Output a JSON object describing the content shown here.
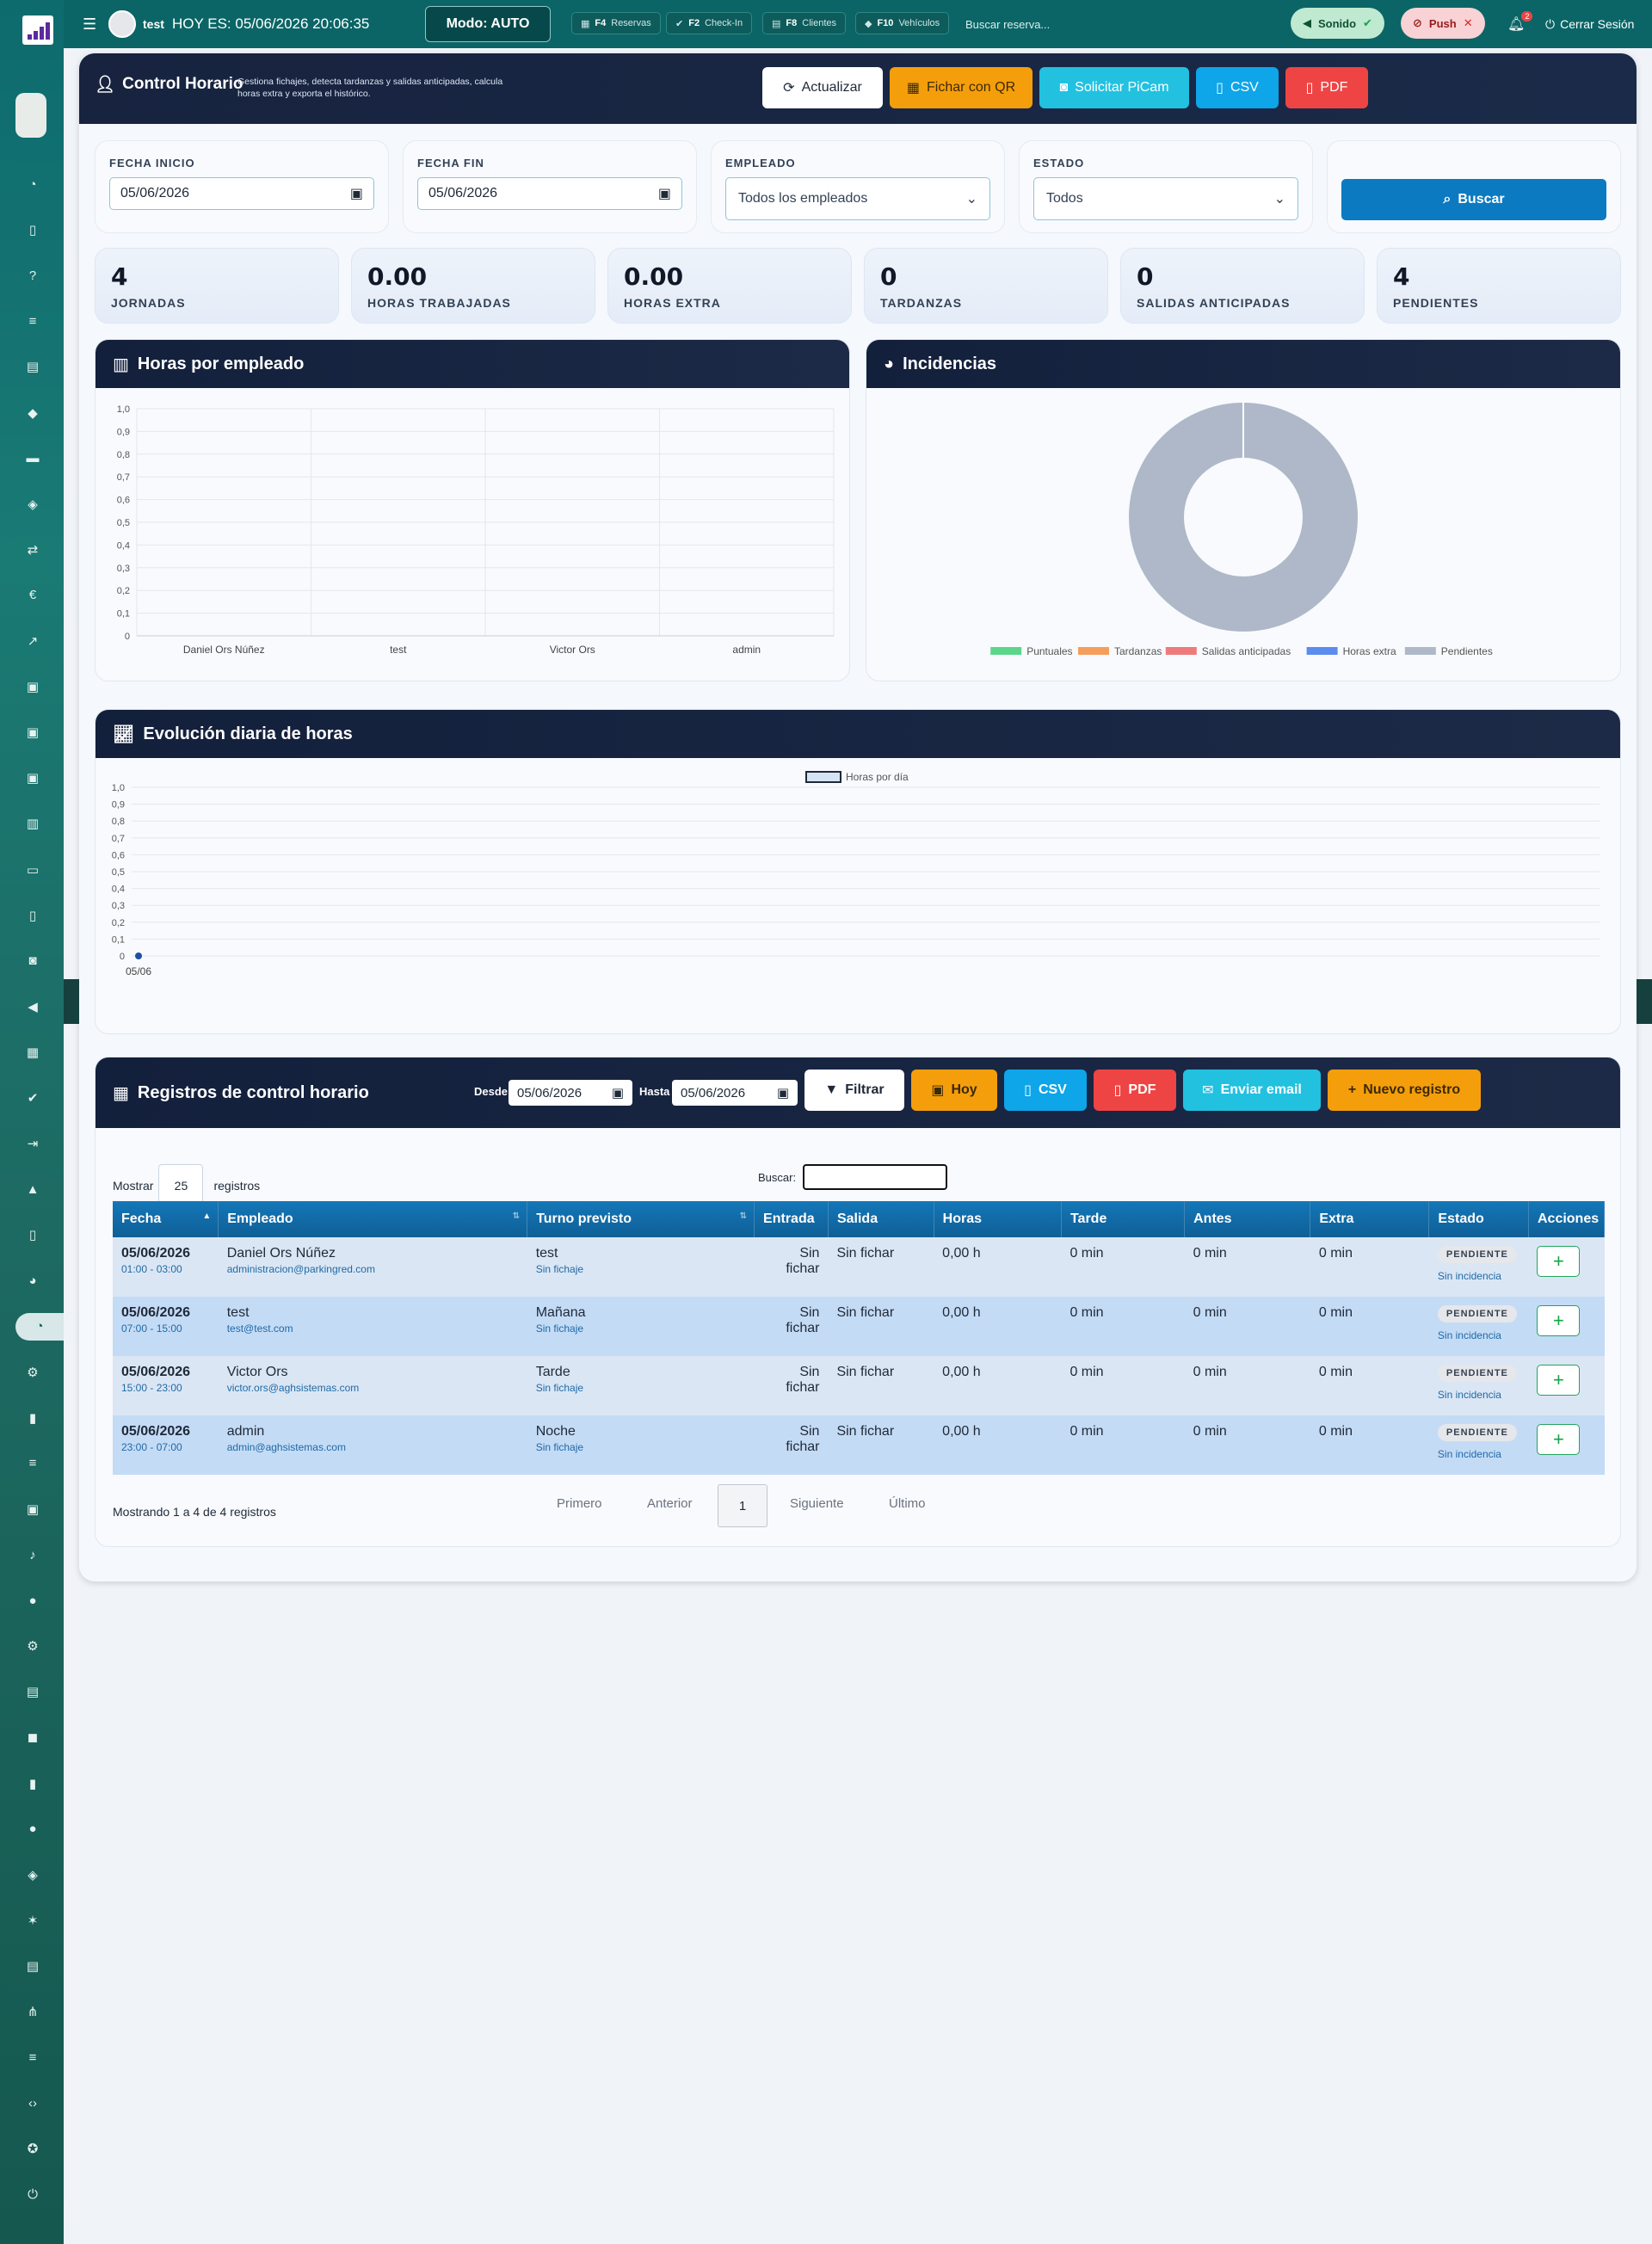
{
  "topbar": {
    "user": "test",
    "date_text": "HOY ES: 05/06/2026 20:06:35",
    "mode": "Modo: AUTO",
    "shortcuts": [
      {
        "key": "F4",
        "label": "Reservas"
      },
      {
        "key": "F2",
        "label": "Check-In"
      },
      {
        "key": "F8",
        "label": "Clientes"
      },
      {
        "key": "F10",
        "label": "Vehículos"
      }
    ],
    "search_placeholder": "Buscar reserva...",
    "sound": "Sonido",
    "push": "Push",
    "notif_count": "2",
    "logout": "Cerrar Sesión"
  },
  "header": {
    "title": "Control Horario",
    "subtitle": "Gestiona fichajes, detecta tardanzas y salidas anticipadas, calcula horas extra y exporta el histórico.",
    "buttons": {
      "refresh": "Actualizar",
      "qr": "Fichar con QR",
      "picam": "Solicitar PiCam",
      "csv": "CSV",
      "pdf": "PDF"
    }
  },
  "filters": {
    "start_label": "FECHA INICIO",
    "start_value": "05/06/2026",
    "end_label": "FECHA FIN",
    "end_value": "05/06/2026",
    "employee_label": "EMPLEADO",
    "employee_value": "Todos los empleados",
    "state_label": "ESTADO",
    "state_value": "Todos",
    "search_button": "Buscar"
  },
  "stats": [
    {
      "value": "4",
      "label": "JORNADAS"
    },
    {
      "value": "0.00",
      "label": "HORAS TRABAJADAS"
    },
    {
      "value": "0.00",
      "label": "HORAS EXTRA"
    },
    {
      "value": "0",
      "label": "TARDANZAS"
    },
    {
      "value": "0",
      "label": "SALIDAS ANTICIPADAS"
    },
    {
      "value": "4",
      "label": "PENDIENTES"
    }
  ],
  "panels": {
    "hours": "Horas por empleado",
    "incidents": "Incidencias",
    "evolution": "Evolución diaria de horas",
    "records": "Registros de control horario"
  },
  "chart_data": [
    {
      "type": "bar",
      "title": "Horas por empleado",
      "categories": [
        "Daniel Ors Núñez",
        "test",
        "Victor Ors",
        "admin"
      ],
      "values": [
        0,
        0,
        0,
        0
      ],
      "ylim": [
        0,
        1.0
      ],
      "yticks": [
        "0",
        "0,1",
        "0,2",
        "0,3",
        "0,4",
        "0,5",
        "0,6",
        "0,7",
        "0,8",
        "0,9",
        "1,0"
      ],
      "grid": true
    },
    {
      "type": "pie",
      "title": "Incidencias",
      "donut": true,
      "labels": [
        "Puntuales",
        "Tardanzas",
        "Salidas anticipadas",
        "Horas extra",
        "Pendientes"
      ],
      "values": [
        0,
        0,
        0,
        0,
        4
      ],
      "colors": [
        "#5cd68a",
        "#f59e5b",
        "#ef7a7a",
        "#5b8def",
        "#aeb8c8"
      ],
      "legend": "bottom"
    },
    {
      "type": "line",
      "title": "Evolución diaria de horas",
      "series": [
        {
          "name": "Horas por día",
          "x": [
            "05/06"
          ],
          "values": [
            0
          ]
        }
      ],
      "ylim": [
        0,
        1.0
      ],
      "yticks": [
        "0",
        "0,1",
        "0,2",
        "0,3",
        "0,4",
        "0,5",
        "0,6",
        "0,7",
        "0,8",
        "0,9",
        "1,0"
      ],
      "legend": "top",
      "grid": true
    }
  ],
  "records": {
    "desde_label": "Desde",
    "desde_value": "05/06/2026",
    "hasta_label": "Hasta",
    "hasta_value": "05/06/2026",
    "buttons": {
      "filter": "Filtrar",
      "today": "Hoy",
      "csv": "CSV",
      "pdf": "PDF",
      "email": "Enviar email",
      "new": "Nuevo registro"
    },
    "show_label": "Mostrar",
    "show_value": "25",
    "show_suffix": "registros",
    "search_label": "Buscar:",
    "columns": [
      "Fecha",
      "Empleado",
      "Turno previsto",
      "Entrada",
      "Salida",
      "Horas",
      "Tarde",
      "Antes",
      "Extra",
      "Estado",
      "Acciones"
    ],
    "rows": [
      {
        "date": "05/06/2026",
        "range": "01:00 - 03:00",
        "name": "Daniel Ors Núñez",
        "email": "administracion@parkingred.com",
        "shift": "test",
        "shift_sub": "Sin fichaje",
        "in": "Sin fichar",
        "out": "Sin fichar",
        "hours": "0,00 h",
        "late": "0 min",
        "early": "0 min",
        "extra": "0 min",
        "state": "PENDIENTE",
        "state_sub": "Sin incidencia",
        "action": "+"
      },
      {
        "date": "05/06/2026",
        "range": "07:00 - 15:00",
        "name": "test",
        "email": "test@test.com",
        "shift": "Mañana",
        "shift_sub": "Sin fichaje",
        "in": "Sin fichar",
        "out": "Sin fichar",
        "hours": "0,00 h",
        "late": "0 min",
        "early": "0 min",
        "extra": "0 min",
        "state": "PENDIENTE",
        "state_sub": "Sin incidencia",
        "action": "+"
      },
      {
        "date": "05/06/2026",
        "range": "15:00 - 23:00",
        "name": "Victor Ors",
        "email": "victor.ors@aghsistemas.com",
        "shift": "Tarde",
        "shift_sub": "Sin fichaje",
        "in": "Sin fichar",
        "out": "Sin fichar",
        "hours": "0,00 h",
        "late": "0 min",
        "early": "0 min",
        "extra": "0 min",
        "state": "PENDIENTE",
        "state_sub": "Sin incidencia",
        "action": "+"
      },
      {
        "date": "05/06/2026",
        "range": "23:00 - 07:00",
        "name": "admin",
        "email": "admin@aghsistemas.com",
        "shift": "Noche",
        "shift_sub": "Sin fichaje",
        "in": "Sin fichar",
        "out": "Sin fichar",
        "hours": "0,00 h",
        "late": "0 min",
        "early": "0 min",
        "extra": "0 min",
        "state": "PENDIENTE",
        "state_sub": "Sin incidencia",
        "action": "+"
      }
    ],
    "info": "Mostrando 1 a 4 de 4 registros",
    "pagination": {
      "first": "Primero",
      "prev": "Anterior",
      "page": "1",
      "next": "Siguiente",
      "last": "Último"
    }
  }
}
